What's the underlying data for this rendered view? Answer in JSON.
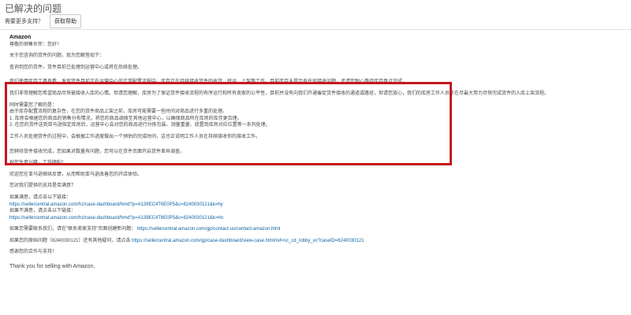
{
  "header": {
    "title": "已解决的问题",
    "help_prompt": "需要更多支持？",
    "help_button": "获取帮助"
  },
  "message": {
    "sender": "Amazon",
    "greeting": "尊敬的销售伙伴：您好！",
    "intro": "关于您咨询的货件的问题，现为您解答如下：",
    "check_line": "查询到您的货件，货件目前已处理到运营中心或将在后续处理。",
    "highlight_p1": "我们使用库存工具查看，发现货件目前正在运营中心的正常配置流程中，库存正在持续接收货件的收货、转运、上架等工作。目前库存未提示有任何接收问题，还请您耐心等待库存盘点完成。",
    "highlight_p2": "我们非常理解您希望商品尽快被接收入库的心情。但请您理解，库房为了保证货件接收流程的有序运行和所有卖家的公平性，目前并没有向我们开通催促货件接收的通道或路径，但请您放心，我们的库房工作人员正在尽最大努力尽快完成货件的入库上架流程。",
    "highlight_p3": "同时需要您了解的是：",
    "highlight_p4": "由于库存配置流程的复杂性，在您的货件商品上架之前，库房可能需要一些时间对商品进行多重的处理。",
    "highlight_p5": "1. 库房会根据您的商品的销售分布情况，将您的商品调拨至其他运营中心，以确保商品所在库房的库存更合理。",
    "highlight_p6": "2. 在您的货件送到亚马逊指定库房后，运营中心会对您的商品进行分拣包装、测量重量、放置到库房对应位置等一系列处理。",
    "highlight_p7": "工作人员处理货件的过程中，会根据工作进度做出一个预估的完成时间，这也正说明工作人员在持续接收你的接收工作。",
    "after_p1": "您稍待货件接收完成，您如果对数量有问题，您可以在货件页面开启货件差异调查。",
    "after_p2": "祝您生意兴隆，工作顺利！",
    "after_p3": "欢迎您在亚马逊继续反馈，从而帮助亚马逊改善您的开店体验。",
    "after_p4": "您对我们提供的支持是否满意？",
    "yes_label": "如果满意，请点击以下链接：",
    "yes_link": "https://sellercentral.amazon.com/hz/case-dashboard/hmd?p=A139EC4T6E0P5&c=8240030121&k=hy",
    "no_label": "如果不满意，请点击以下链接：",
    "no_link": "https://sellercentral.amazon.com/hz/case-dashboard/hmd?p=A139EC4T6E0P5&c=8240030121&k=hn",
    "contact_label": "如果您需要联系我们，请在\"联系卖家支持\"页面创建新问题：",
    "contact_link": "https://sellercentral.amazon.com/gp/contact-us/contact-amazon.html",
    "reply_label": "如果您的原始问题（8240030121）还有其他疑问，请点击",
    "reply_link": "https://sellercentral.amazon.com/gp/case-dashboard/view-case.html/ref=sc_cd_lobby_vc?caseID=8240030121",
    "thanks": "感谢您的合作与支持！",
    "closing": "Thank you for selling with Amazon,"
  },
  "colors": {
    "highlight_border": "#c8161d",
    "link": "#0b63a5"
  }
}
